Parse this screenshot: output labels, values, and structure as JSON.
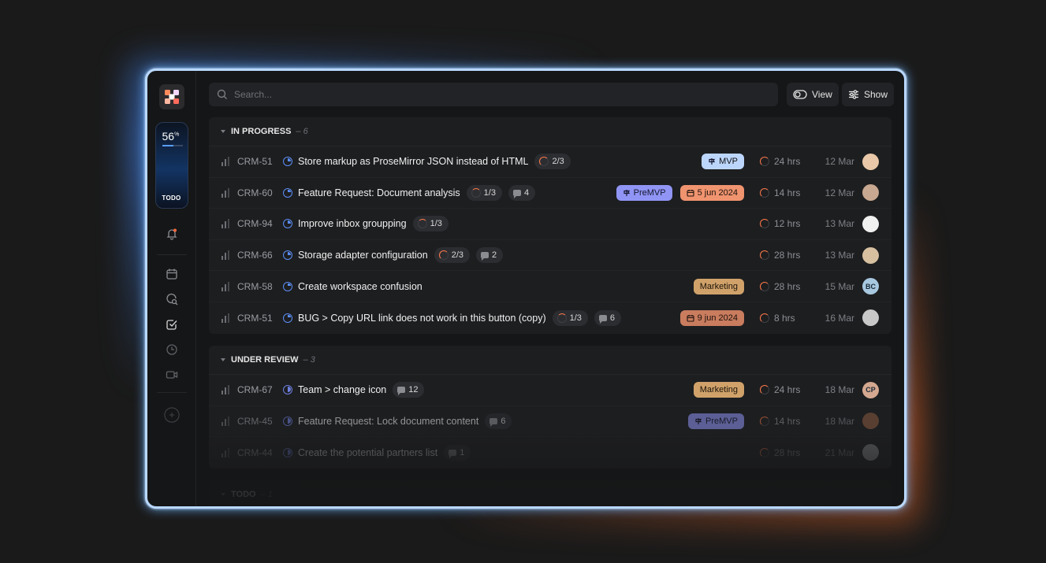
{
  "sidebar": {
    "progress": {
      "percent_value": "56",
      "percent_symbol": "%",
      "fraction": 0.56,
      "label": "TODO"
    },
    "icons": [
      "bell-icon",
      "calendar-icon",
      "chat-search-icon",
      "task-check-icon",
      "clock-icon",
      "video-icon",
      "add-icon"
    ]
  },
  "topbar": {
    "search_placeholder": "Search...",
    "view_label": "View",
    "show_label": "Show"
  },
  "groups": [
    {
      "name": "IN PROGRESS",
      "count": "– 6",
      "rows": [
        {
          "id": "CRM-51",
          "title": "Store markup as ProseMirror JSON instead of HTML",
          "subtasks": "2/3",
          "comments": "",
          "tags": [
            {
              "kind": "mvp",
              "label": "MVP"
            }
          ],
          "hours": "24 hrs",
          "date": "12 Mar",
          "avatar": ""
        },
        {
          "id": "CRM-60",
          "title": "Feature Request: Document analysis",
          "subtasks": "1/3",
          "comments": "4",
          "tags": [
            {
              "kind": "premvp",
              "label": "PreMVP"
            },
            {
              "kind": "date",
              "label": "5 jun 2024"
            }
          ],
          "hours": "14 hrs",
          "date": "12 Mar",
          "avatar": ""
        },
        {
          "id": "CRM-94",
          "title": "Improve inbox groupping",
          "subtasks": "1/3",
          "comments": "",
          "tags": [],
          "hours": "12 hrs",
          "date": "13 Mar",
          "avatar": ""
        },
        {
          "id": "CRM-66",
          "title": "Storage adapter configuration",
          "subtasks": "2/3",
          "comments": "2",
          "tags": [],
          "hours": "28 hrs",
          "date": "13 Mar",
          "avatar": ""
        },
        {
          "id": "CRM-58",
          "title": "Create workspace confusion",
          "subtasks": "",
          "comments": "",
          "tags": [
            {
              "kind": "mkt",
              "label": "Marketing"
            }
          ],
          "hours": "28 hrs",
          "date": "15 Mar",
          "avatar": "BC"
        },
        {
          "id": "CRM-51",
          "title": "BUG > Copy URL link does not work in this button (copy)",
          "subtasks": "1/3",
          "comments": "6",
          "tags": [
            {
              "kind": "date2",
              "label": "9 jun 2024"
            }
          ],
          "hours": "8 hrs",
          "date": "16 Mar",
          "avatar": ""
        }
      ]
    },
    {
      "name": "UNDER REVIEW",
      "count": "– 3",
      "rows": [
        {
          "id": "CRM-67",
          "title": "Team > change icon",
          "subtasks": "",
          "comments": "12",
          "tags": [
            {
              "kind": "mkt",
              "label": "Marketing"
            }
          ],
          "hours": "24 hrs",
          "date": "18 Mar",
          "avatar": "CP"
        },
        {
          "id": "CRM-45",
          "title": "Feature Request: Lock document content",
          "subtasks": "",
          "comments": "6",
          "tags": [
            {
              "kind": "premvp",
              "label": "PreMVP"
            }
          ],
          "hours": "14 hrs",
          "date": "18 Mar",
          "avatar": ""
        },
        {
          "id": "CRM-44",
          "title": "Create the potential partners list",
          "subtasks": "",
          "comments": "1",
          "tags": [],
          "hours": "28 hrs",
          "date": "21 Mar",
          "avatar": ""
        }
      ]
    },
    {
      "name": "TODO",
      "count": "– 1",
      "rows": []
    }
  ],
  "colors": {
    "accent_blue": "#5b8ef5",
    "progress_orange": "#ff7a4a",
    "mvp": "#bcd6fb",
    "premvp": "#9095f5",
    "date": "#f0946f",
    "marketing": "#d0a26a"
  }
}
